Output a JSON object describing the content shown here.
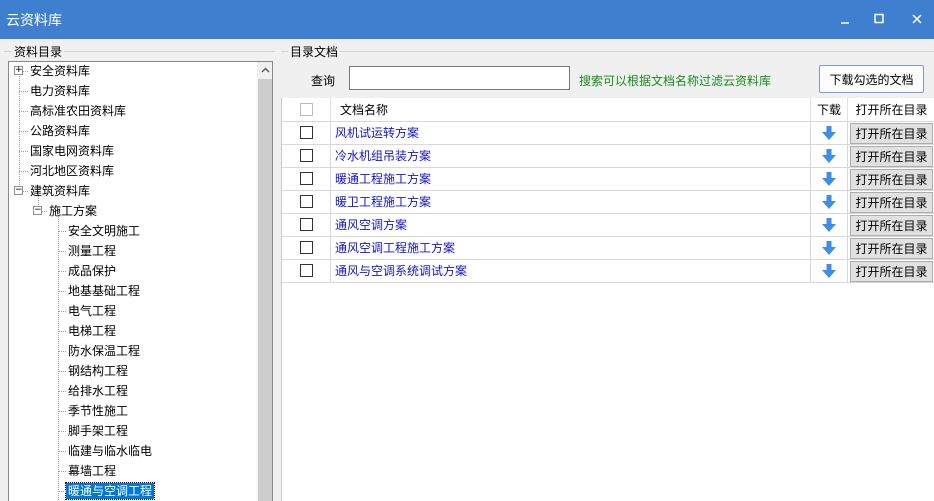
{
  "window": {
    "title": "云资料库",
    "controls": [
      "minimize-icon",
      "maximize-icon",
      "close-icon"
    ]
  },
  "tree_panel": {
    "title": "资料目录",
    "items": [
      {
        "label": "安全资料库",
        "expander": "+"
      },
      {
        "label": "电力资料库"
      },
      {
        "label": "高标准农田资料库"
      },
      {
        "label": "公路资料库"
      },
      {
        "label": "国家电网资料库"
      },
      {
        "label": "河北地区资料库"
      },
      {
        "label": "建筑资料库",
        "expander": "−"
      },
      {
        "label": "施工方案",
        "expander": "−"
      },
      {
        "label": "安全文明施工"
      },
      {
        "label": "测量工程"
      },
      {
        "label": "成品保护"
      },
      {
        "label": "地基基础工程"
      },
      {
        "label": "电气工程"
      },
      {
        "label": "电梯工程"
      },
      {
        "label": "防水保温工程"
      },
      {
        "label": "钢结构工程"
      },
      {
        "label": "给排水工程"
      },
      {
        "label": "季节性施工"
      },
      {
        "label": "脚手架工程"
      },
      {
        "label": "临建与临水临电"
      },
      {
        "label": "幕墙工程"
      },
      {
        "label": "暖通与空调工程",
        "selected": true
      }
    ]
  },
  "docs_panel": {
    "title": "目录文档",
    "search": {
      "label": "查询",
      "value": "",
      "hint": "搜索可以根据文档名称过滤云资料库"
    },
    "download_button": "下载勾选的文档",
    "columns": {
      "name": "文档名称",
      "download": "下载",
      "open": "打开所在目录"
    },
    "rows": [
      {
        "name": "风机试运转方案",
        "open_label": "打开所在目录"
      },
      {
        "name": "冷水机组吊装方案",
        "open_label": "打开所在目录"
      },
      {
        "name": "暖通工程施工方案",
        "open_label": "打开所在目录"
      },
      {
        "name": "暖卫工程施工方案",
        "open_label": "打开所在目录"
      },
      {
        "name": "通风空调方案",
        "open_label": "打开所在目录"
      },
      {
        "name": "通风空调工程施工方案",
        "open_label": "打开所在目录"
      },
      {
        "name": "通风与空调系统调试方案",
        "open_label": "打开所在目录"
      }
    ]
  },
  "colors": {
    "titlebar": "#3f7fd0",
    "link": "#1515c8",
    "hint": "#1a8a1a",
    "selection": "#0078d7",
    "download_arrow": "#3d8ee8"
  }
}
